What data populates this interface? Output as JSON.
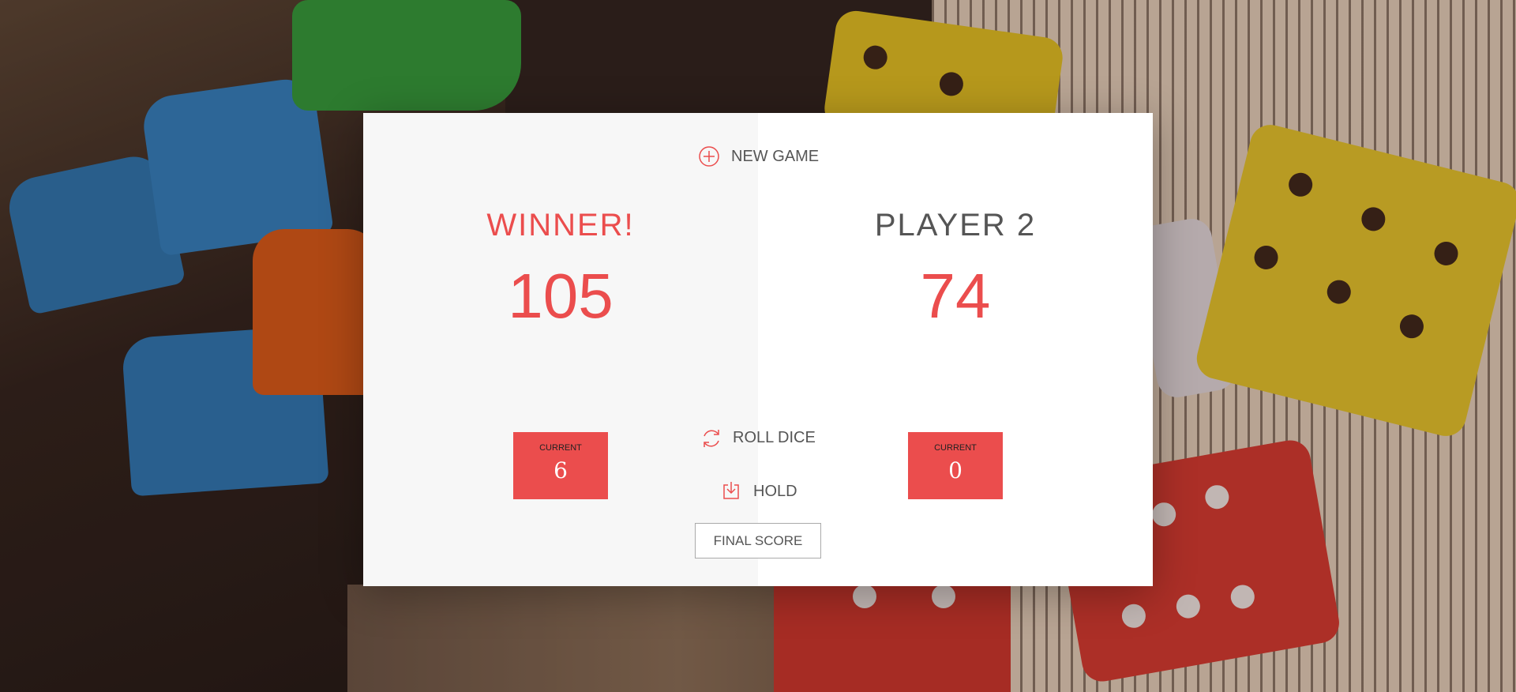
{
  "game": {
    "new_game_label": "New game",
    "roll_dice_label": "Roll dice",
    "hold_label": "Hold",
    "final_score_placeholder": "Final score",
    "final_score_value": ""
  },
  "players": [
    {
      "name": "Winner!",
      "score": "105",
      "current_label": "Current",
      "current_score": "6",
      "is_winner": true
    },
    {
      "name": "Player 2",
      "score": "74",
      "current_label": "Current",
      "current_score": "0",
      "is_winner": false
    }
  ],
  "colors": {
    "accent": "#eb4d4d",
    "panel_left": "#f7f7f7",
    "panel_right": "#ffffff",
    "text": "#555555"
  },
  "icons": {
    "new_game": "plus-circle-icon",
    "roll_dice": "refresh-icon",
    "hold": "download-icon"
  }
}
